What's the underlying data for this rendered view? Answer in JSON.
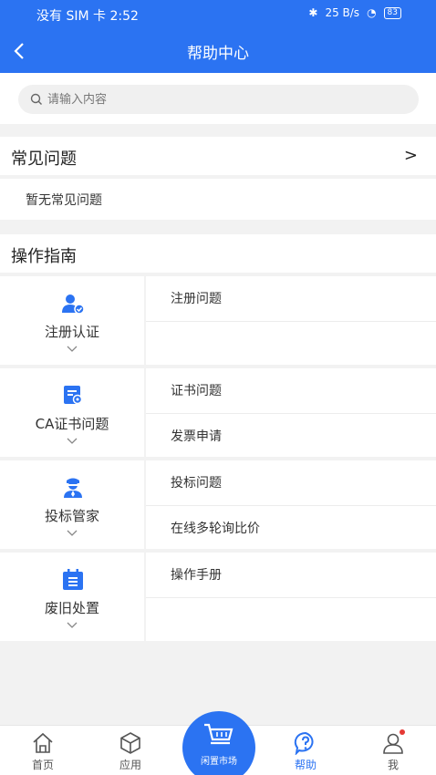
{
  "status": {
    "carrier": "没有 SIM 卡",
    "time": "2:52",
    "signal_text": "25 B/s",
    "battery": "83"
  },
  "nav": {
    "title": "帮助中心"
  },
  "search": {
    "placeholder": "请输入内容"
  },
  "faq": {
    "title": "常见问题",
    "arrow": ">",
    "empty": "暂无常见问题"
  },
  "guide": {
    "title": "操作指南",
    "categories": [
      {
        "label": "注册认证",
        "icon": "user-check-icon",
        "items": [
          "注册问题",
          ""
        ]
      },
      {
        "label": "CA证书问题",
        "icon": "certificate-icon",
        "items": [
          "证书问题",
          "发票申请"
        ]
      },
      {
        "label": "投标管家",
        "icon": "agent-icon",
        "items": [
          "投标问题",
          "在线多轮询比价"
        ]
      },
      {
        "label": "废旧处置",
        "icon": "calendar-list-icon",
        "items": [
          "操作手册",
          ""
        ]
      }
    ]
  },
  "tabbar": {
    "home": "首页",
    "apps": "应用",
    "market": "闲置市场",
    "help": "帮助",
    "me": "我"
  },
  "colors": {
    "primary": "#2b73f2",
    "background": "#f2f2f2",
    "badge": "#e53935"
  }
}
